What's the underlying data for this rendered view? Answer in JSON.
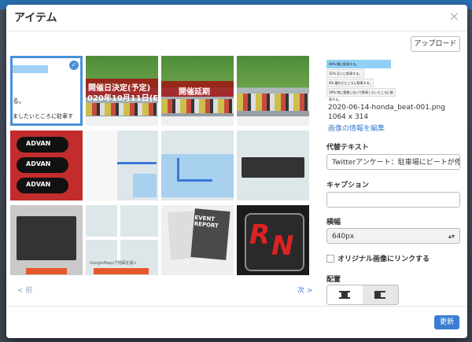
{
  "modal": {
    "title": "アイテム",
    "close_glyph": "×",
    "upload_label": "アップロード"
  },
  "grid": {
    "tile1": {
      "line1": "る。",
      "line2": "ましたいところに駐車す"
    },
    "event_tile1": {
      "line1": "開催日決定(予定)",
      "line2": "020年10月11日(E"
    },
    "event_tile2": {
      "line1": "開催延期"
    },
    "tire_label": "ADVAN",
    "report_title": "EVENT REPORT",
    "map_button_text": "GoogleMapsで地図を開く",
    "prev_label": "< 前",
    "next_label": "次 >"
  },
  "details": {
    "preview_rows": [
      "48% 隣に駐車する。",
      "31% 近くに駐車する。",
      "4% 離れたところに駐車する。",
      "19% 特に意識しないで駐車したいところに駐車する。"
    ],
    "filename": "2020-06-14-honda_beat-001.png",
    "dimensions": "1064 x 314",
    "edit_link": "画像の情報を編集",
    "alt_label": "代替テキスト",
    "alt_value": "Twitterアンケート：駐車場にビートが停",
    "caption_label": "キャプション",
    "caption_value": "",
    "width_label": "横幅",
    "width_value": "640px",
    "link_label": "オリジナル画像にリンクする",
    "align_label": "配置"
  },
  "footer": {
    "update_label": "更新"
  }
}
